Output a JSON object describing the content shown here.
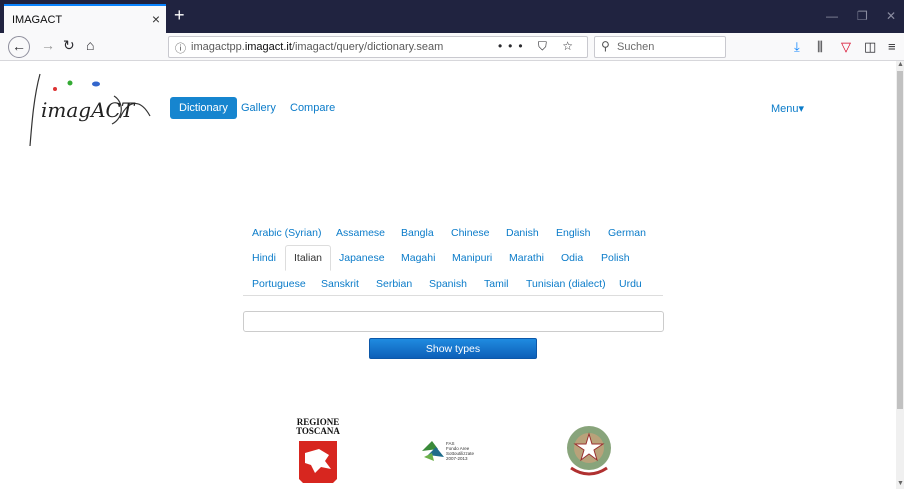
{
  "browser": {
    "tab_title": "IMAGACT",
    "tab_close": "×",
    "new_tab": "+",
    "url_prefix": "imagactpp.",
    "url_domain": "imagact.it",
    "url_path": "/imagact/query/dictionary.seam",
    "url_actions": "••• ⛉ ☆",
    "search_placeholder": "Suchen"
  },
  "site": {
    "logo_text": "imagACT",
    "nav": [
      "Dictionary",
      "Gallery",
      "Compare"
    ],
    "menu_label": "Menu▾"
  },
  "languages": {
    "rows": [
      [
        "Arabic (Syrian)",
        "Assamese",
        "Bangla",
        "Chinese",
        "Danish",
        "English",
        "German"
      ],
      [
        "Hindi",
        "Italian",
        "Japanese",
        "Magahi",
        "Manipuri",
        "Marathi",
        "Odia",
        "Polish"
      ],
      [
        "Portuguese",
        "Sanskrit",
        "Serbian",
        "Spanish",
        "Tamil",
        "Tunisian (dialect)",
        "Urdu"
      ]
    ],
    "selected": "Italian"
  },
  "search": {
    "value": "",
    "button_label": "Show types"
  },
  "footer_logos": {
    "regione_line1": "REGIONE",
    "regione_line2": "TOSCANA",
    "fas_line1": "FAS",
    "fas_line2": "Fondo Aree",
    "fas_line3": "Sottoutilizzate",
    "fas_line4": "2007-2013"
  },
  "colors": {
    "link": "#0a7bc9",
    "active_pill": "#1685cf",
    "button": "#1275cf",
    "tabbar": "#202340"
  }
}
